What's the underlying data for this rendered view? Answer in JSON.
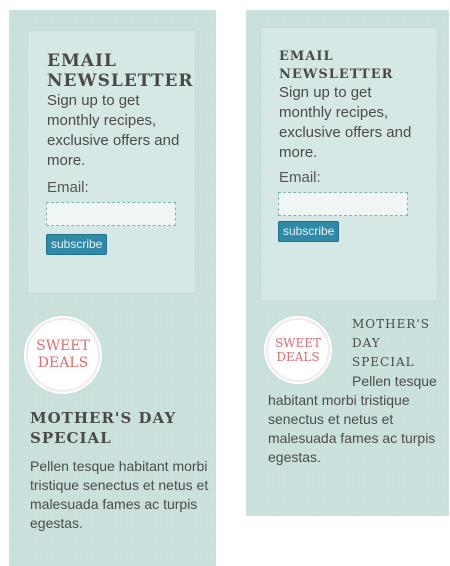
{
  "newsletter": {
    "title_line1": "EMAIL",
    "title_line2": "NEWSLETTER",
    "description": "Sign up to get monthly recipes, exclusive offers and more.",
    "email_label": "Email:",
    "email_value": "",
    "subscribe_label": "subscribe"
  },
  "deal": {
    "badge_line1": "SWEET",
    "badge_line2": "DEALS",
    "title": "MOTHER'S DAY SPECIAL",
    "title_line1": "MOTHER'S",
    "title_line2": "DAY",
    "title_line3": "SPECIAL",
    "description": "Pellen tesque habitant morbi tristique senectus et netus et malesuada fames ac turpis egestas."
  },
  "colors": {
    "panel_bg": "#c9e0dc",
    "box_bg": "#d6e8e5",
    "button_bg": "#2e8aa6",
    "badge_text": "#e06d6d"
  }
}
